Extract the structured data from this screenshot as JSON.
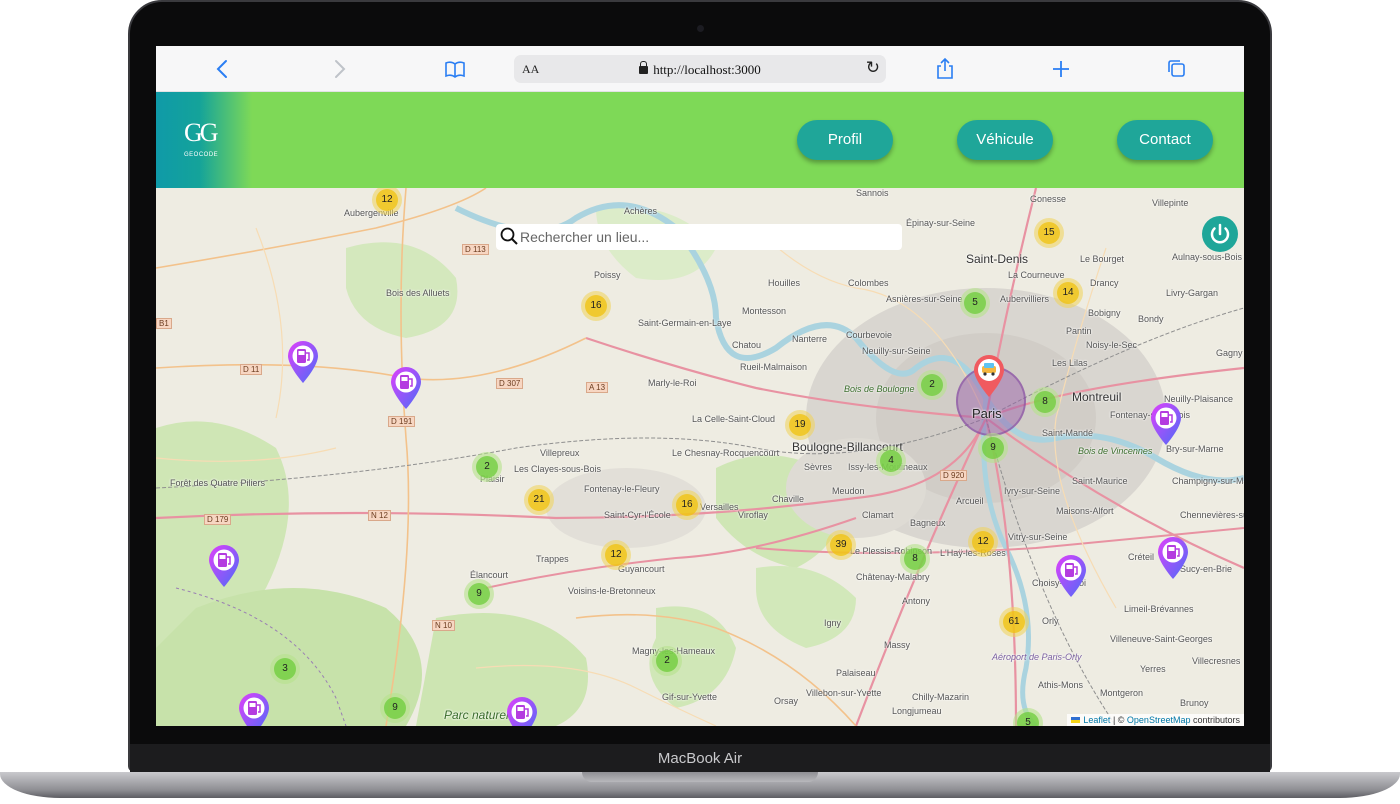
{
  "device": {
    "label": "MacBook Air"
  },
  "browser": {
    "aa_label": "AA",
    "url": "http://localhost:3000"
  },
  "header": {
    "logo_text": "GEOCODE",
    "nav": [
      {
        "label": "Profil"
      },
      {
        "label": "Véhicule"
      },
      {
        "label": "Contact"
      }
    ]
  },
  "search": {
    "placeholder": "Rechercher un lieu..."
  },
  "map": {
    "places": [
      "Aubergenville",
      "Achères",
      "Sannois",
      "Épinay-sur-Seine",
      "Saint-Denis",
      "Gonesse",
      "Villepinte",
      "Poissy",
      "Houilles",
      "Colombes",
      "Asnières-sur-Seine",
      "Le Bourget",
      "Aulnay-sous-Bois",
      "Saint-Germain-en-Laye",
      "Montesson",
      "Courbevoie",
      "La Courneuve",
      "Aubervilliers",
      "Drancy",
      "Livry-Gargan",
      "Chatou",
      "Nanterre",
      "Neuilly-sur-Seine",
      "Pantin",
      "Bobigny",
      "Bondy",
      "Noisy-le-Sec",
      "Gagny",
      "Rueil-Malmaison",
      "Les Lilas",
      "Marly-le-Roi",
      "Montreuil",
      "Neuilly-Plaisance",
      "Fontenay-sous-Bois",
      "La Celle-Saint-Cloud",
      "Saint-Mandé",
      "Bry-sur-Marne",
      "Villepreux",
      "Le Chesnay-Rocquencourt",
      "Boulogne-Billancourt",
      "Les Clayes-sous-Bois",
      "Plaisir",
      "Fontenay-le-Fleury",
      "Sèvres",
      "Issy-les-Moulineaux",
      "Saint-Maurice",
      "Champigny-sur-Marne",
      "Chaville",
      "Meudon",
      "Ivry-sur-Seine",
      "Arcueil",
      "Saint-Cyr-l'École",
      "Versailles",
      "Viroflay",
      "Clamart",
      "Bagneux",
      "Maisons-Alfort",
      "Chennevières-sur-Marne",
      "Trappes",
      "Guyancourt",
      "Vitry-sur-Seine",
      "Le Plessis-Robinson",
      "L'Haÿ-les-Roses",
      "Créteil",
      "Sucy-en-Brie",
      "Élancourt",
      "Châtenay-Malabry",
      "Choisy-le-Roi",
      "Voisins-le-Bretonneux",
      "Antony",
      "Limeil-Brévannes",
      "Igny",
      "Orly",
      "Villeneuve-Saint-Georges",
      "Magny-les-Hameaux",
      "Massy",
      "Villecresnes",
      "Palaiseau",
      "Yerres",
      "Gif-sur-Yvette",
      "Athis-Mons",
      "Montgeron",
      "Orsay",
      "Villebon-sur-Yvette",
      "Chilly-Mazarin",
      "Brunoy",
      "Longjumeau",
      "Bois des Alluets",
      "Forêt des Quatre Piliers",
      "Parc naturel",
      "Bois de Boulogne",
      "Bois de Vincennes",
      "Aéroport de Paris-Orly",
      "Paris"
    ],
    "road_shields": [
      "D 113",
      "D 11",
      "D 191",
      "D 307",
      "A 13",
      "N 12",
      "D 179",
      "N 10",
      "D 920",
      "B1"
    ],
    "clusters": [
      {
        "count": "12",
        "color": "yellow"
      },
      {
        "count": "15",
        "color": "yellow"
      },
      {
        "count": "16",
        "color": "yellow"
      },
      {
        "count": "14",
        "color": "yellow"
      },
      {
        "count": "5",
        "color": "green"
      },
      {
        "count": "2",
        "color": "green"
      },
      {
        "count": "8",
        "color": "green"
      },
      {
        "count": "19",
        "color": "yellow"
      },
      {
        "count": "9",
        "color": "green"
      },
      {
        "count": "2",
        "color": "green"
      },
      {
        "count": "21",
        "color": "yellow"
      },
      {
        "count": "4",
        "color": "green"
      },
      {
        "count": "16",
        "color": "yellow"
      },
      {
        "count": "12",
        "color": "yellow"
      },
      {
        "count": "39",
        "color": "yellow"
      },
      {
        "count": "8",
        "color": "green"
      },
      {
        "count": "12",
        "color": "yellow"
      },
      {
        "count": "9",
        "color": "green"
      },
      {
        "count": "61",
        "color": "yellow"
      },
      {
        "count": "2",
        "color": "green"
      },
      {
        "count": "3",
        "color": "green"
      },
      {
        "count": "9",
        "color": "green"
      },
      {
        "count": "5",
        "color": "green"
      }
    ],
    "attribution": {
      "leaflet": "Leaflet",
      "separator": " | © ",
      "osm": "OpenStreetMap",
      "suffix": " contributors"
    }
  },
  "colors": {
    "header": "#7ed957",
    "button": "#1fa699",
    "cluster_yellow": "#f0c20c",
    "cluster_green": "#6ecc39",
    "pin_gradient": [
      "#e040fb",
      "#4a6cf7"
    ]
  }
}
